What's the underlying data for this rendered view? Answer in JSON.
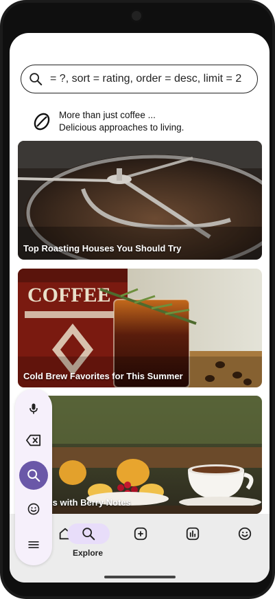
{
  "search": {
    "query": "= ?, sort = rating, order = desc, limit = 2",
    "icon": "search-icon"
  },
  "tagline": {
    "line1": "More than just coffee ...",
    "line2": "Delicious approaches to living.",
    "icon": "coffee-bean-icon"
  },
  "cards": [
    {
      "title": "Top Roasting Houses You Should Try"
    },
    {
      "title": "Cold Brew Favorites for This Summer"
    },
    {
      "title": "e Beans with Berry Notes"
    }
  ],
  "bottom_nav": {
    "items": [
      {
        "label": "",
        "icon": "home-icon"
      },
      {
        "label": "Explore",
        "icon": "search-icon"
      },
      {
        "label": "",
        "icon": "add-icon"
      },
      {
        "label": "",
        "icon": "stats-icon"
      },
      {
        "label": "",
        "icon": "smiley-icon"
      }
    ]
  },
  "voice_panel": {
    "buttons": [
      "microphone-icon",
      "backspace-icon",
      "search-icon",
      "smiley-icon",
      "menu-icon"
    ],
    "active_color": "#6a58a8"
  }
}
